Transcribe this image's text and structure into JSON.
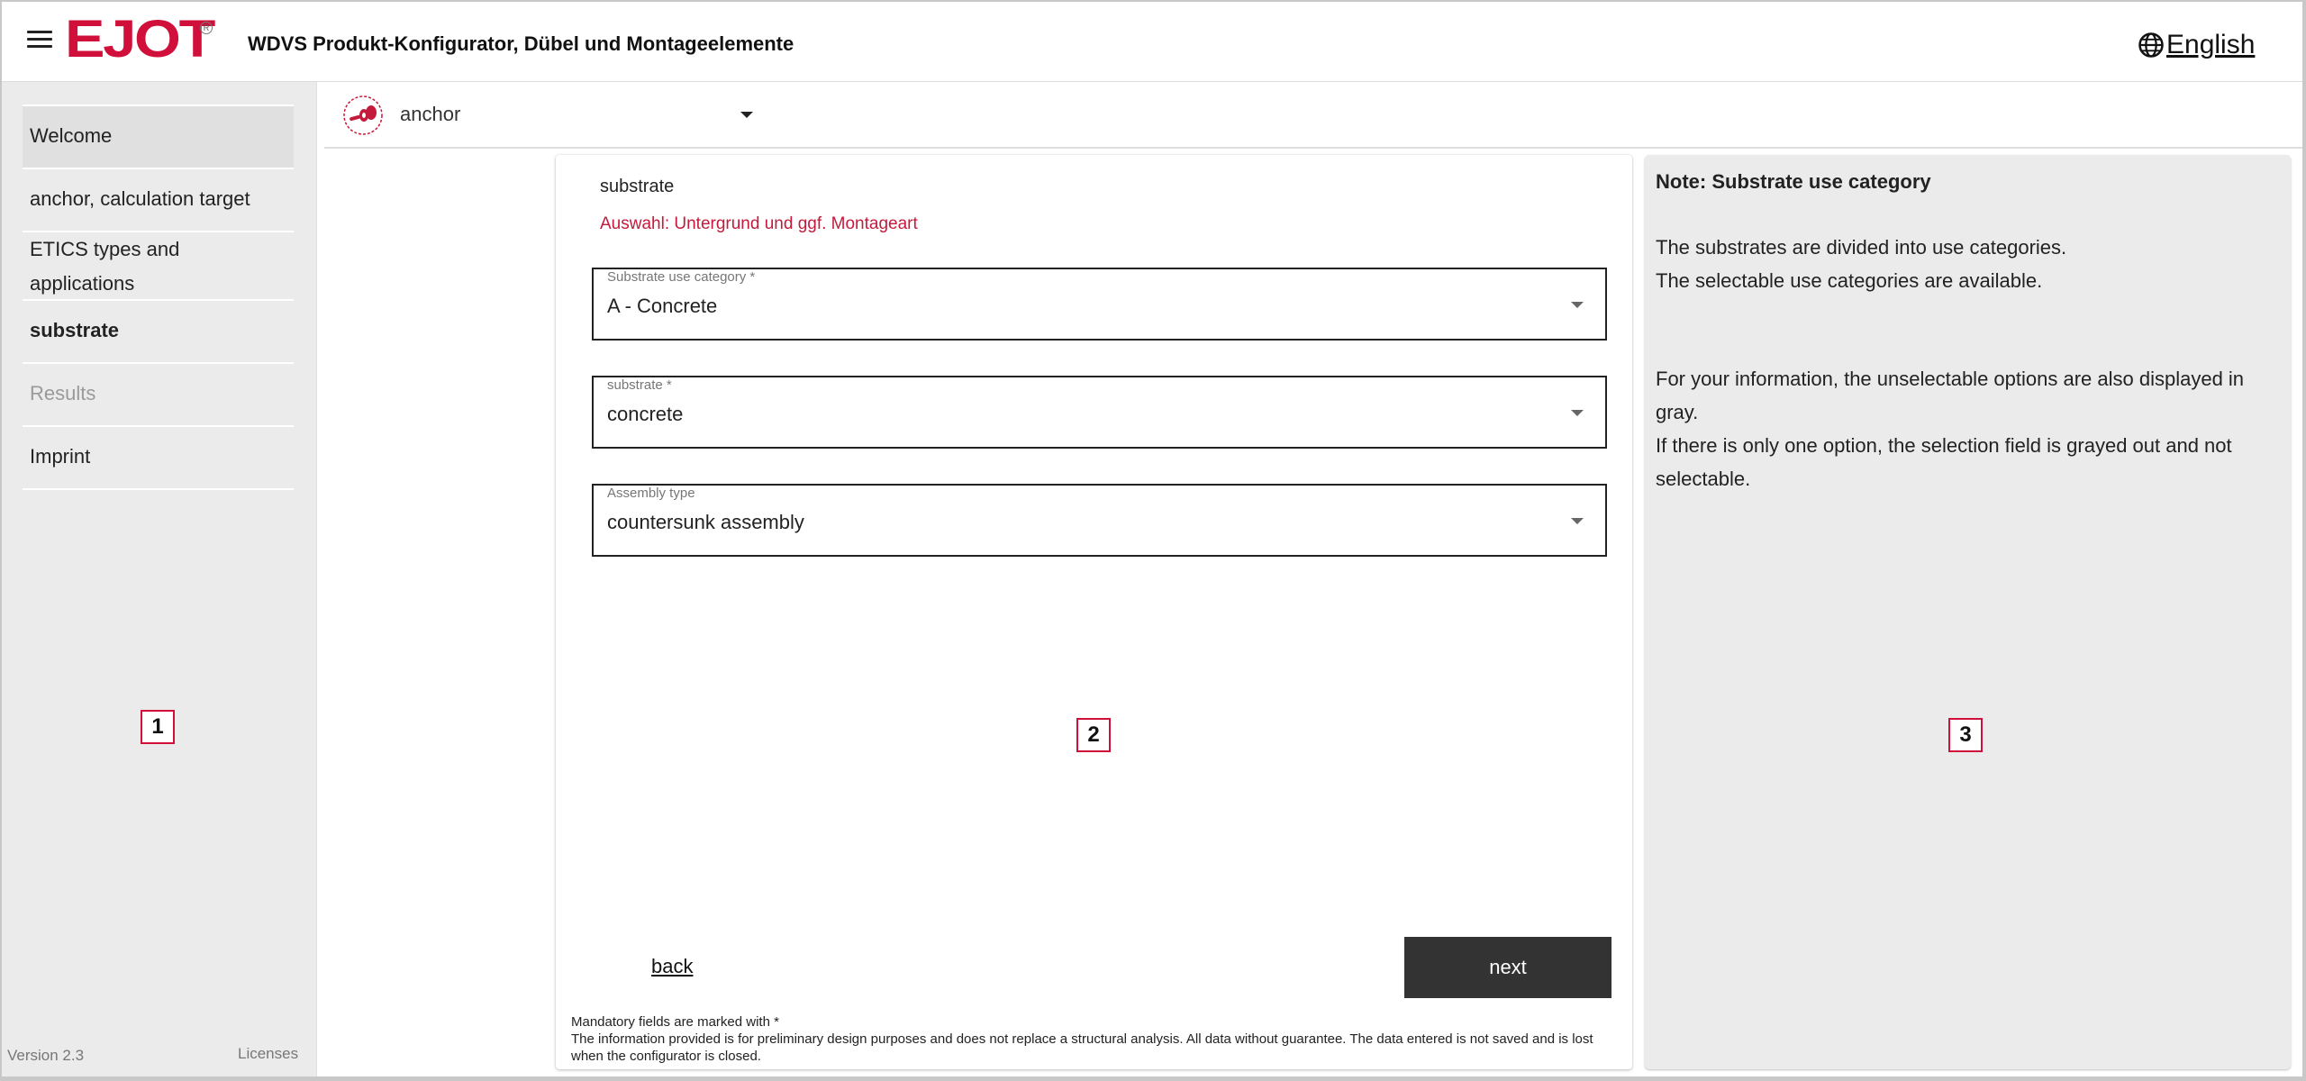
{
  "header": {
    "brand": "EJOT",
    "title": "WDVS Produkt-Konfigurator, Dübel und Montageelemente",
    "language_label": "English",
    "icons": {
      "menu": "hamburger-menu-icon",
      "language": "globe-icon"
    }
  },
  "sidebar": {
    "items": [
      {
        "label": "Welcome",
        "state": "highlighted"
      },
      {
        "label": "anchor, calculation target",
        "state": "normal"
      },
      {
        "label": "ETICS types and applications",
        "state": "normal"
      },
      {
        "label": "substrate",
        "state": "current"
      },
      {
        "label": "Results",
        "state": "disabled"
      },
      {
        "label": "Imprint",
        "state": "normal"
      }
    ],
    "version": "Version 2.3",
    "licenses_label": "Licenses"
  },
  "selector": {
    "label": "anchor",
    "icon": "anchor-icon"
  },
  "main": {
    "title": "substrate",
    "subtitle": "Auswahl: Untergrund und ggf. Montageart",
    "fields": [
      {
        "label": "Substrate use category *",
        "value": "A - Concrete"
      },
      {
        "label": "substrate *",
        "value": "concrete"
      },
      {
        "label": "Assembly type",
        "value": "countersunk assembly"
      }
    ],
    "back_label": "back",
    "next_label": "next",
    "footnote_line1": "Mandatory fields are marked with *",
    "footnote_line2": "The information provided is for preliminary design purposes and does not replace a structural analysis. All data without guarantee. The data entered is not saved and is lost when the configurator is closed."
  },
  "note": {
    "title": "Note: Substrate use category",
    "paragraph1_line1": "The substrates are divided into use categories.",
    "paragraph1_line2": "The selectable use categories are available.",
    "paragraph2_line1": "For your information, the unselectable options are also displayed in gray.",
    "paragraph2_line2": "If there is only one option, the selection field is grayed out and not selectable."
  },
  "markers": [
    "1",
    "2",
    "3"
  ],
  "colors": {
    "brand_red": "#d0103a",
    "subtitle_red": "#c41a3b",
    "button_dark": "#333333",
    "sidebar_bg": "#ebebeb"
  }
}
